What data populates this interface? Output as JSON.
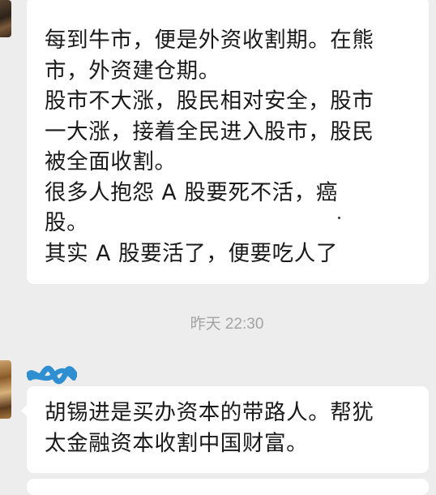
{
  "messages": [
    {
      "lines": [
        "每到牛市，便是外资收割期。在熊",
        "市，外资建仓期。",
        "股市不大涨，股民相对安全，股市",
        "一大涨，接着全民进入股市，股民",
        "被全面收割。",
        "很多人抱怨 A 股要死不活，癌",
        "股。",
        "其实 A 股要活了，便要吃人了"
      ]
    },
    {
      "lines": [
        "胡锡进是买办资本的带路人。帮犹",
        "太金融资本收割中国财富。"
      ]
    }
  ],
  "timestamp": "昨天 22:30",
  "colors": {
    "background": "#ededed",
    "bubble": "#ffffff",
    "text": "#1a1a1a",
    "timestamp": "#a3a3a3",
    "scribble": "#2f8fd0"
  }
}
